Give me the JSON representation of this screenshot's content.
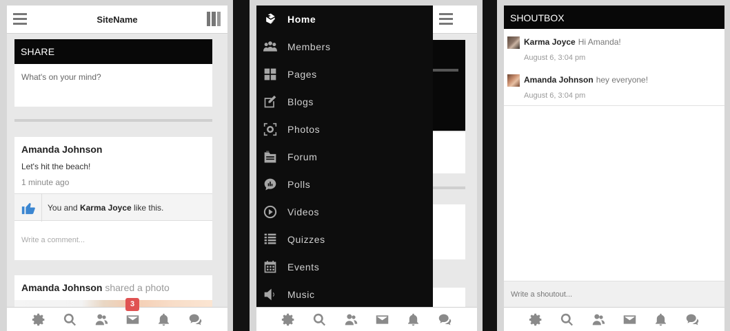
{
  "panel1": {
    "site_name": "SiteName",
    "share": {
      "title": "SHARE",
      "placeholder": "What's on your mind?"
    },
    "post1": {
      "author": "Amanda Johnson",
      "text": "Let's hit the beach!",
      "time": "1 minute ago",
      "likes": {
        "prefix": "You and",
        "name": "Karma Joyce",
        "suffix": "like this."
      },
      "comment_placeholder": "Write a comment..."
    },
    "post2": {
      "author": "Amanda Johnson",
      "action": "shared a photo"
    },
    "notification_badge": "3"
  },
  "panel2": {
    "menu": [
      {
        "label": "Home",
        "icon": "home-icon",
        "active": true
      },
      {
        "label": "Members",
        "icon": "members-icon"
      },
      {
        "label": "Pages",
        "icon": "pages-icon"
      },
      {
        "label": "Blogs",
        "icon": "blogs-icon"
      },
      {
        "label": "Photos",
        "icon": "photos-icon"
      },
      {
        "label": "Forum",
        "icon": "forum-icon"
      },
      {
        "label": "Polls",
        "icon": "polls-icon"
      },
      {
        "label": "Videos",
        "icon": "videos-icon"
      },
      {
        "label": "Quizzes",
        "icon": "quizzes-icon"
      },
      {
        "label": "Events",
        "icon": "events-icon"
      },
      {
        "label": "Music",
        "icon": "music-icon"
      }
    ]
  },
  "panel3": {
    "title": "SHOUTBOX",
    "messages": [
      {
        "name": "Karma Joyce",
        "text": "Hi Amanda!",
        "time": "August 6, 3:04 pm"
      },
      {
        "name": "Amanda Johnson",
        "text": "hey everyone!",
        "time": "August 6, 3:04 pm"
      }
    ],
    "input_placeholder": "Write a shoutout..."
  },
  "bottom_bar": [
    "settings-icon",
    "search-icon",
    "friends-icon",
    "messages-icon",
    "notifications-icon",
    "chat-icon"
  ],
  "colors": {
    "header_bg": "#080808",
    "like_blue": "#3b86d1",
    "badge_red": "#e05252"
  }
}
